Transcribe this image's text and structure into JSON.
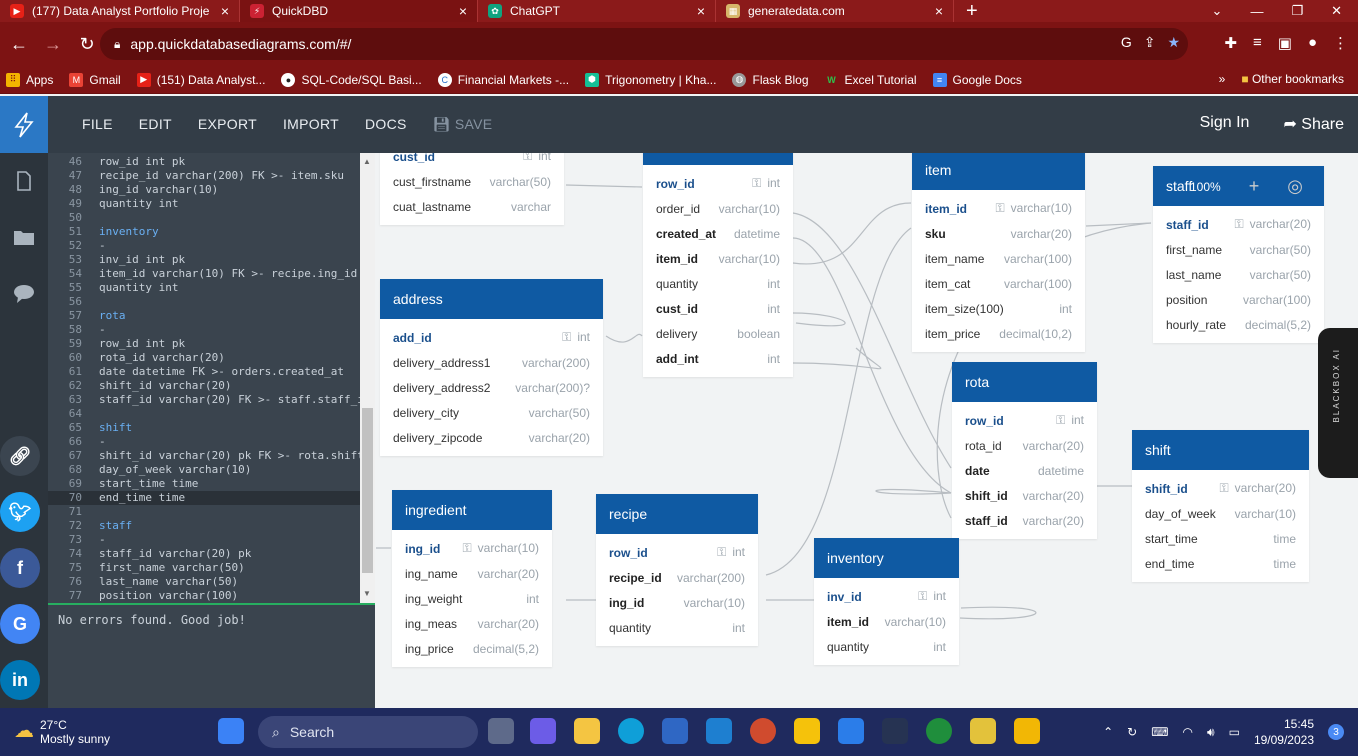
{
  "browser": {
    "tabs": [
      {
        "label": "(177) Data Analyst Portfolio Proje",
        "icon": "youtube-icon",
        "color": "#e62117"
      },
      {
        "label": "QuickDBD",
        "icon": "quickdbd-icon",
        "color": "#c23"
      },
      {
        "label": "ChatGPT",
        "icon": "chatgpt-icon",
        "color": "#10a37f"
      },
      {
        "label": "generatedata.com",
        "icon": "generatedata-icon",
        "color": "#d6b56a"
      }
    ],
    "url": "app.quickdatabasediagrams.com/#/",
    "bookmarks": [
      {
        "label": "Apps",
        "icon": "apps-icon",
        "color": "#f4b400"
      },
      {
        "label": "Gmail",
        "icon": "gmail-icon",
        "color": "#ea4335"
      },
      {
        "label": "(151) Data Analyst...",
        "icon": "youtube-icon",
        "color": "#e62117"
      },
      {
        "label": "SQL-Code/SQL Basi...",
        "icon": "github-icon",
        "color": "#222"
      },
      {
        "label": "Financial Markets -...",
        "icon": "coursera-icon",
        "color": "#2a73cc"
      },
      {
        "label": "Trigonometry | Kha...",
        "icon": "khan-icon",
        "color": "#14bf96"
      },
      {
        "label": "Flask Blog",
        "icon": "globe-icon",
        "color": "#888"
      },
      {
        "label": "Excel Tutorial",
        "icon": "w-icon",
        "color": "#1e8c3a"
      },
      {
        "label": "Google Docs",
        "icon": "docs-icon",
        "color": "#4285f4"
      }
    ],
    "other_bookmarks": "Other bookmarks"
  },
  "app": {
    "menu": [
      "FILE",
      "EDIT",
      "EXPORT",
      "IMPORT",
      "DOCS"
    ],
    "save": "SAVE",
    "sign_in": "Sign In",
    "share": "Share",
    "zoom": "100%"
  },
  "editor": {
    "lines": [
      {
        "n": "46",
        "t": "row_id int pk",
        "kw": false
      },
      {
        "n": "47",
        "t": "recipe_id varchar(200) FK >- item.sku",
        "kw": false
      },
      {
        "n": "48",
        "t": "ing_id varchar(10)",
        "kw": false
      },
      {
        "n": "49",
        "t": "quantity int",
        "kw": false
      },
      {
        "n": "50",
        "t": "",
        "kw": false
      },
      {
        "n": "51",
        "t": "inventory",
        "kw": true
      },
      {
        "n": "52",
        "t": "-",
        "kw": false
      },
      {
        "n": "53",
        "t": "inv_id int pk",
        "kw": false
      },
      {
        "n": "54",
        "t": "item_id varchar(10) FK >- recipe.ing_id",
        "kw": false
      },
      {
        "n": "55",
        "t": "quantity int",
        "kw": false
      },
      {
        "n": "56",
        "t": "",
        "kw": false
      },
      {
        "n": "57",
        "t": "rota",
        "kw": true
      },
      {
        "n": "58",
        "t": "-",
        "kw": false
      },
      {
        "n": "59",
        "t": "row_id int pk",
        "kw": false
      },
      {
        "n": "60",
        "t": "rota_id varchar(20)",
        "kw": false
      },
      {
        "n": "61",
        "t": "date datetime FK >- orders.created_at",
        "kw": false
      },
      {
        "n": "62",
        "t": "shift_id varchar(20)",
        "kw": false
      },
      {
        "n": "63",
        "t": "staff_id varchar(20) FK >- staff.staff_i",
        "kw": false
      },
      {
        "n": "64",
        "t": "",
        "kw": false
      },
      {
        "n": "65",
        "t": "shift",
        "kw": true
      },
      {
        "n": "66",
        "t": "-",
        "kw": false
      },
      {
        "n": "67",
        "t": "shift_id varchar(20) pk FK >- rota.shift",
        "kw": false
      },
      {
        "n": "68",
        "t": "day_of_week varchar(10)",
        "kw": false
      },
      {
        "n": "69",
        "t": "start_time time",
        "kw": false
      },
      {
        "n": "70",
        "t": "end_time time",
        "kw": false
      },
      {
        "n": "71",
        "t": "",
        "kw": false
      },
      {
        "n": "72",
        "t": "staff",
        "kw": true
      },
      {
        "n": "73",
        "t": "-",
        "kw": false
      },
      {
        "n": "74",
        "t": "staff_id varchar(20) pk",
        "kw": false
      },
      {
        "n": "75",
        "t": "first_name varchar(50)",
        "kw": false
      },
      {
        "n": "76",
        "t": "last_name varchar(50)",
        "kw": false
      },
      {
        "n": "77",
        "t": "position varchar(100)",
        "kw": false
      }
    ],
    "status": "No errors found. Good job!"
  },
  "tables": {
    "customers": {
      "title": "",
      "rows": [
        {
          "name": "cust_id",
          "type": "int",
          "style": "pk",
          "key": true
        },
        {
          "name": "cust_firstname",
          "type": "varchar(50)",
          "style": "",
          "key": false
        },
        {
          "name": "cuat_lastname",
          "type": "varchar",
          "style": "",
          "key": false
        }
      ]
    },
    "orders": {
      "title": "orders",
      "rows": [
        {
          "name": "row_id",
          "type": "int",
          "style": "pk",
          "key": true
        },
        {
          "name": "order_id",
          "type": "varchar(10)",
          "style": "",
          "key": false
        },
        {
          "name": "created_at",
          "type": "datetime",
          "style": "b",
          "key": false
        },
        {
          "name": "item_id",
          "type": "varchar(10)",
          "style": "b",
          "key": false
        },
        {
          "name": "quantity",
          "type": "int",
          "style": "",
          "key": false
        },
        {
          "name": "cust_id",
          "type": "int",
          "style": "b",
          "key": false
        },
        {
          "name": "delivery",
          "type": "boolean",
          "style": "",
          "key": false
        },
        {
          "name": "add_int",
          "type": "int",
          "style": "b",
          "key": false
        }
      ]
    },
    "item": {
      "title": "item",
      "rows": [
        {
          "name": "item_id",
          "type": "varchar(10)",
          "style": "pk",
          "key": true
        },
        {
          "name": "sku",
          "type": "varchar(20)",
          "style": "b",
          "key": false
        },
        {
          "name": "item_name",
          "type": "varchar(100)",
          "style": "",
          "key": false
        },
        {
          "name": "item_cat",
          "type": "varchar(100)",
          "style": "",
          "key": false
        },
        {
          "name": "item_size(100)",
          "type": "int",
          "style": "",
          "key": false
        },
        {
          "name": "item_price",
          "type": "decimal(10,2)",
          "style": "",
          "key": false
        }
      ]
    },
    "staff": {
      "title": "staff",
      "rows": [
        {
          "name": "staff_id",
          "type": "varchar(20)",
          "style": "pk",
          "key": true
        },
        {
          "name": "first_name",
          "type": "varchar(50)",
          "style": "",
          "key": false
        },
        {
          "name": "last_name",
          "type": "varchar(50)",
          "style": "",
          "key": false
        },
        {
          "name": "position",
          "type": "varchar(100)",
          "style": "",
          "key": false
        },
        {
          "name": "hourly_rate",
          "type": "decimal(5,2)",
          "style": "",
          "key": false
        }
      ]
    },
    "address": {
      "title": "address",
      "rows": [
        {
          "name": "add_id",
          "type": "int",
          "style": "pk",
          "key": true
        },
        {
          "name": "delivery_address1",
          "type": "varchar(200)",
          "style": "",
          "key": false
        },
        {
          "name": "delivery_address2",
          "type": "varchar(200)?",
          "style": "",
          "key": false
        },
        {
          "name": "delivery_city",
          "type": "varchar(50)",
          "style": "",
          "key": false
        },
        {
          "name": "delivery_zipcode",
          "type": "varchar(20)",
          "style": "",
          "key": false
        }
      ]
    },
    "rota": {
      "title": "rota",
      "rows": [
        {
          "name": "row_id",
          "type": "int",
          "style": "pk",
          "key": true
        },
        {
          "name": "rota_id",
          "type": "varchar(20)",
          "style": "",
          "key": false
        },
        {
          "name": "date",
          "type": "datetime",
          "style": "b",
          "key": false
        },
        {
          "name": "shift_id",
          "type": "varchar(20)",
          "style": "b",
          "key": false
        },
        {
          "name": "staff_id",
          "type": "varchar(20)",
          "style": "b",
          "key": false
        }
      ]
    },
    "shift": {
      "title": "shift",
      "rows": [
        {
          "name": "shift_id",
          "type": "varchar(20)",
          "style": "pk",
          "key": true
        },
        {
          "name": "day_of_week",
          "type": "varchar(10)",
          "style": "",
          "key": false
        },
        {
          "name": "start_time",
          "type": "time",
          "style": "",
          "key": false
        },
        {
          "name": "end_time",
          "type": "time",
          "style": "",
          "key": false
        }
      ]
    },
    "ingredient": {
      "title": "ingredient",
      "rows": [
        {
          "name": "ing_id",
          "type": "varchar(10)",
          "style": "pk",
          "key": true
        },
        {
          "name": "ing_name",
          "type": "varchar(20)",
          "style": "",
          "key": false
        },
        {
          "name": "ing_weight",
          "type": "int",
          "style": "",
          "key": false
        },
        {
          "name": "ing_meas",
          "type": "varchar(20)",
          "style": "",
          "key": false
        },
        {
          "name": "ing_price",
          "type": "decimal(5,2)",
          "style": "",
          "key": false
        }
      ]
    },
    "recipe": {
      "title": "recipe",
      "rows": [
        {
          "name": "row_id",
          "type": "int",
          "style": "pk",
          "key": true
        },
        {
          "name": "recipe_id",
          "type": "varchar(200)",
          "style": "b",
          "key": false
        },
        {
          "name": "ing_id",
          "type": "varchar(10)",
          "style": "b",
          "key": false
        },
        {
          "name": "quantity",
          "type": "int",
          "style": "",
          "key": false
        }
      ]
    },
    "inventory": {
      "title": "inventory",
      "rows": [
        {
          "name": "inv_id",
          "type": "int",
          "style": "pk",
          "key": true
        },
        {
          "name": "item_id",
          "type": "varchar(10)",
          "style": "b",
          "key": false
        },
        {
          "name": "quantity",
          "type": "int",
          "style": "",
          "key": false
        }
      ]
    }
  },
  "blackbox": "BLACKBOX AI",
  "taskbar": {
    "temp": "27°C",
    "weather": "Mostly sunny",
    "search": "Search",
    "time": "15:45",
    "date": "19/09/2023",
    "notif": "3"
  }
}
